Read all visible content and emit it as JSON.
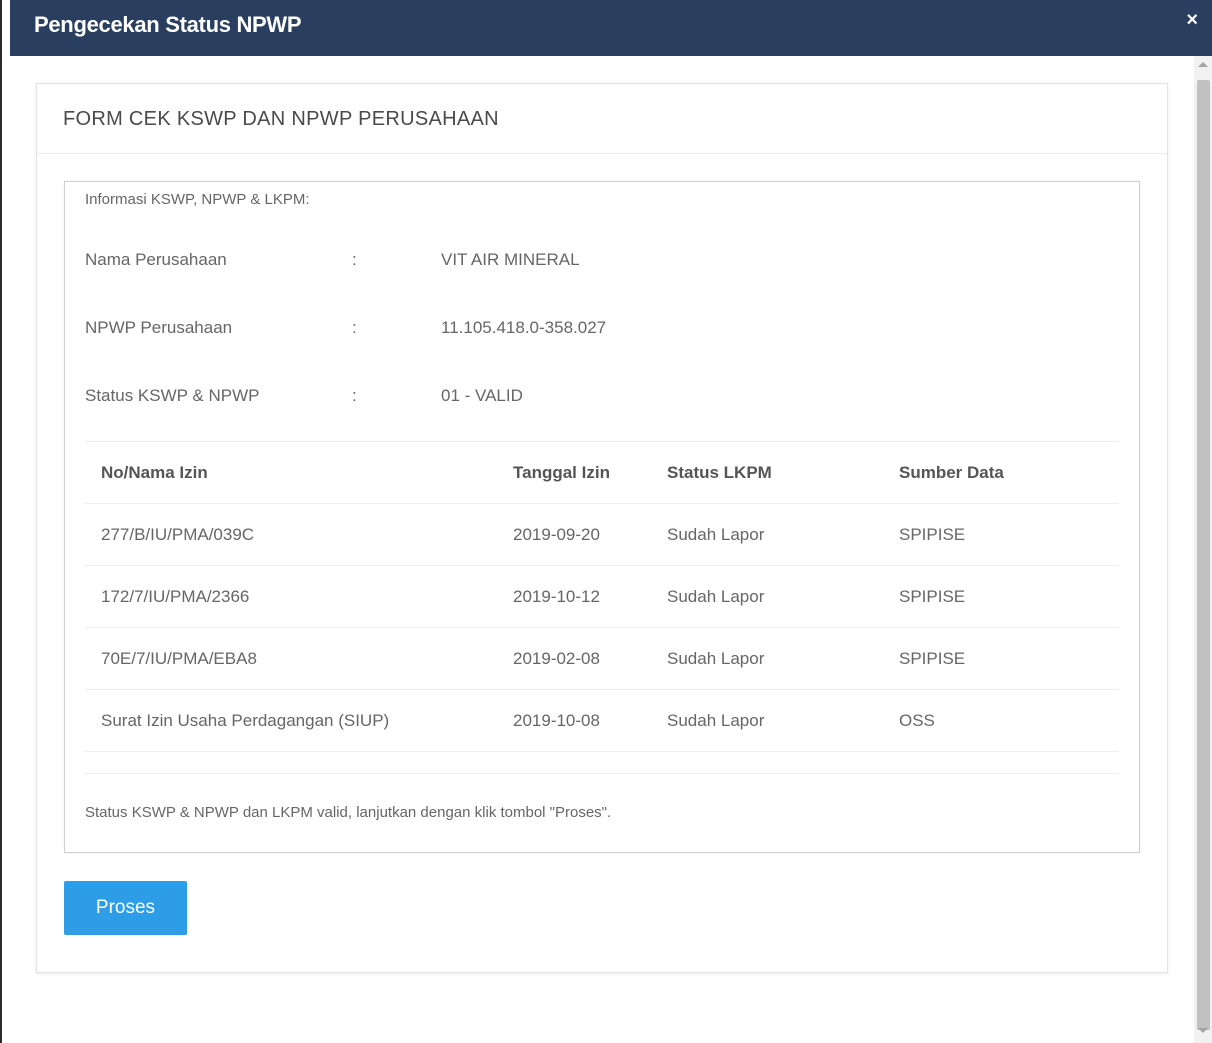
{
  "modal": {
    "title": "Pengecekan Status NPWP",
    "close_glyph": "×"
  },
  "panel": {
    "heading": "FORM CEK KSWP DAN NPWP PERUSAHAAN"
  },
  "info": {
    "title": "Informasi KSWP, NPWP & LKPM:",
    "fields": [
      {
        "label": "Nama Perusahaan",
        "sep": ":",
        "value": "VIT AIR MINERAL"
      },
      {
        "label": "NPWP Perusahaan",
        "sep": ":",
        "value": "11.105.418.0-358.027"
      },
      {
        "label": "Status KSWP & NPWP",
        "sep": ":",
        "value": "01 - VALID"
      }
    ]
  },
  "table": {
    "headers": [
      "No/Nama Izin",
      "Tanggal Izin",
      "Status LKPM",
      "Sumber Data"
    ],
    "rows": [
      [
        "277/B/IU/PMA/039C",
        "2019-09-20",
        "Sudah Lapor",
        "SPIPISE"
      ],
      [
        "172/7/IU/PMA/2366",
        "2019-10-12",
        "Sudah Lapor",
        "SPIPISE"
      ],
      [
        "70E/7/IU/PMA/EBA8",
        "2019-02-08",
        "Sudah Lapor",
        "SPIPISE"
      ],
      [
        "Surat Izin Usaha Perdagangan (SIUP)",
        "2019-10-08",
        "Sudah Lapor",
        "OSS"
      ]
    ]
  },
  "note": "Status KSWP & NPWP dan LKPM valid, lanjutkan dengan klik tombol \"Proses\".",
  "actions": {
    "proses_label": "Proses"
  },
  "colors": {
    "header_bg": "#2a3f5f",
    "button_bg": "#2d9de8"
  }
}
